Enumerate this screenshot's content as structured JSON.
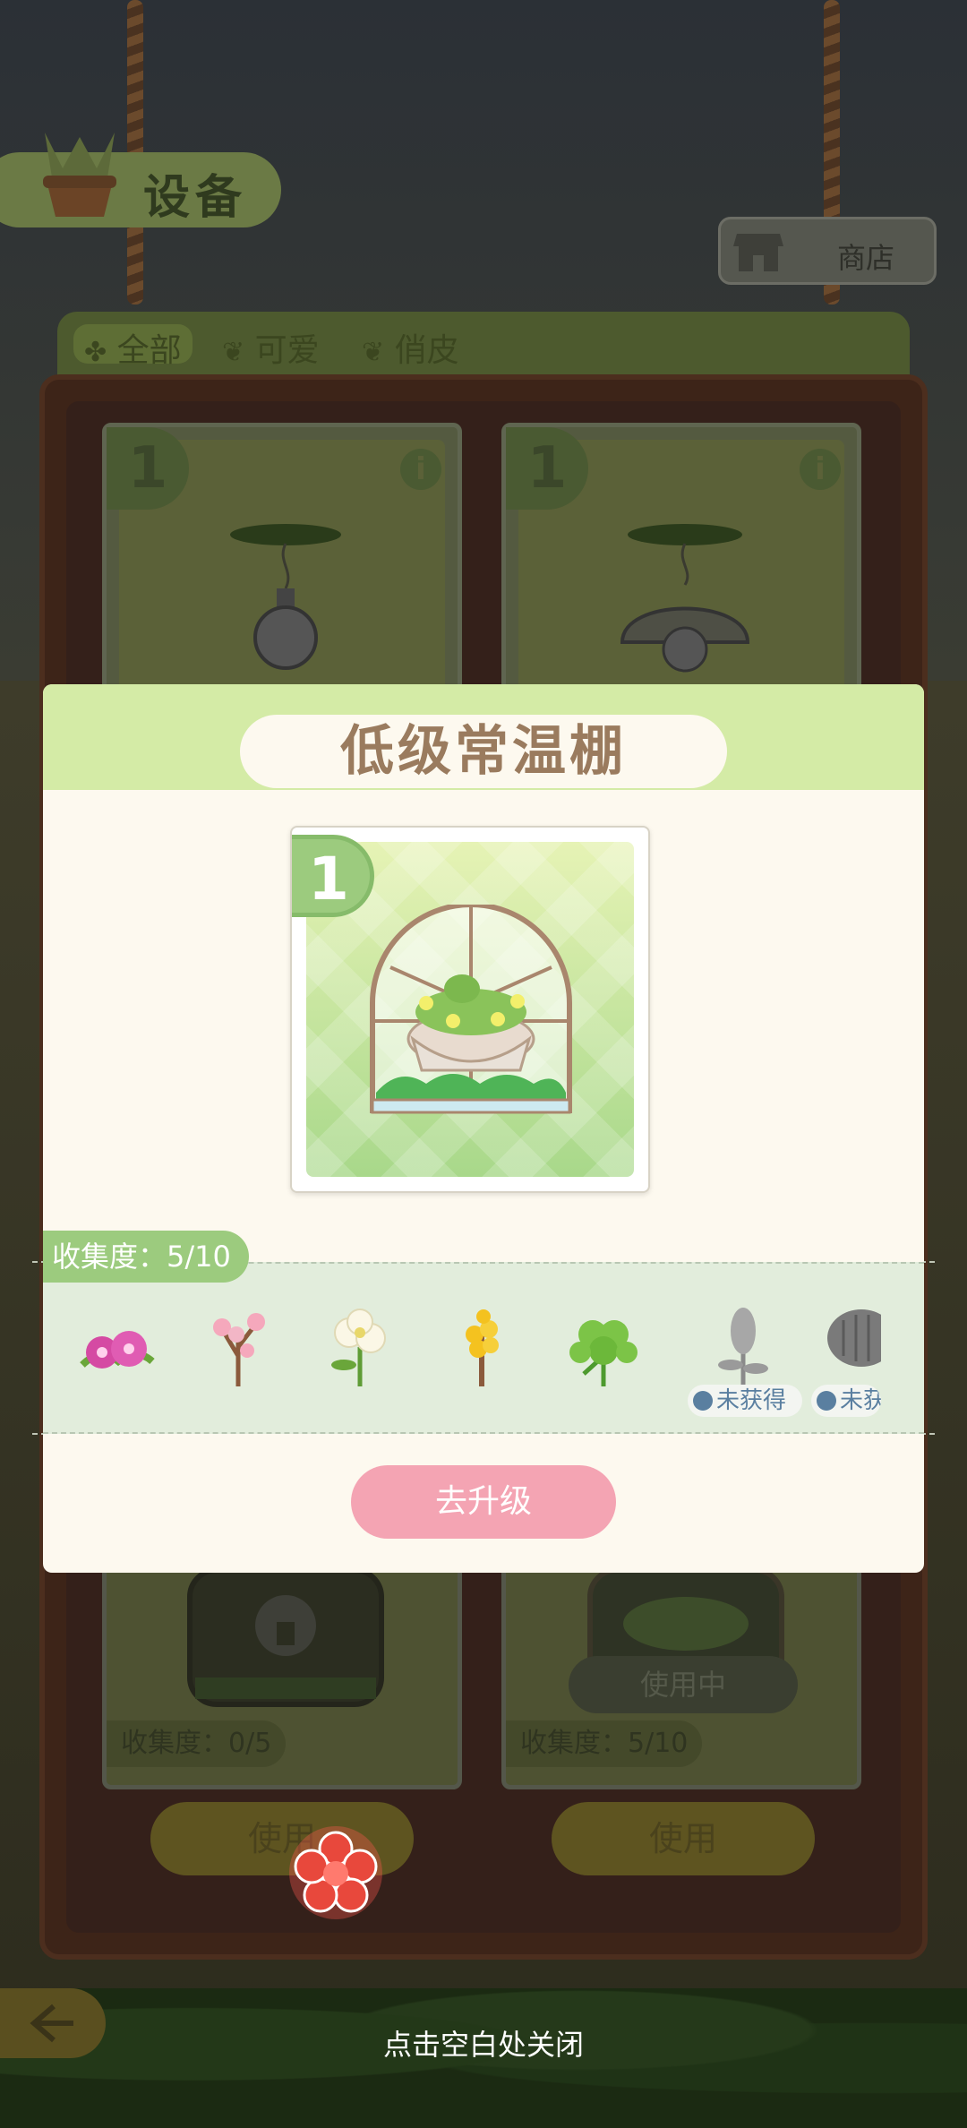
{
  "header": {
    "title": "设备",
    "shop_label": "商店"
  },
  "filters": [
    {
      "label": "全部",
      "active": true
    },
    {
      "label": "可爱",
      "active": false
    },
    {
      "label": "俏皮",
      "active": false
    }
  ],
  "background_cards": [
    {
      "level": "1",
      "collection": "收集度：0/5",
      "button": "使用",
      "in_use": ""
    },
    {
      "level": "1",
      "collection": "收集度：5/10",
      "button": "使用",
      "in_use": "使用中"
    }
  ],
  "modal": {
    "title": "低级常温棚",
    "level": "1",
    "collection_label": "收集度：5/10",
    "plants": [
      {
        "name": "pink-flower",
        "obtained": true
      },
      {
        "name": "cherry-blossom",
        "obtained": true
      },
      {
        "name": "white-flower",
        "obtained": true
      },
      {
        "name": "yellow-flower",
        "obtained": true
      },
      {
        "name": "clover",
        "obtained": true
      },
      {
        "name": "lavender",
        "obtained": false,
        "status": "未获得"
      },
      {
        "name": "cactus",
        "obtained": false,
        "status": "未获"
      }
    ],
    "upgrade_label": "去升级"
  },
  "close_hint": "点击空白处关闭",
  "colors": {
    "modal_header": "#d4eba6",
    "badge_green": "#9ccb7e",
    "upgrade_pink": "#f4a4b3",
    "title_brown": "#9a7b5e"
  }
}
